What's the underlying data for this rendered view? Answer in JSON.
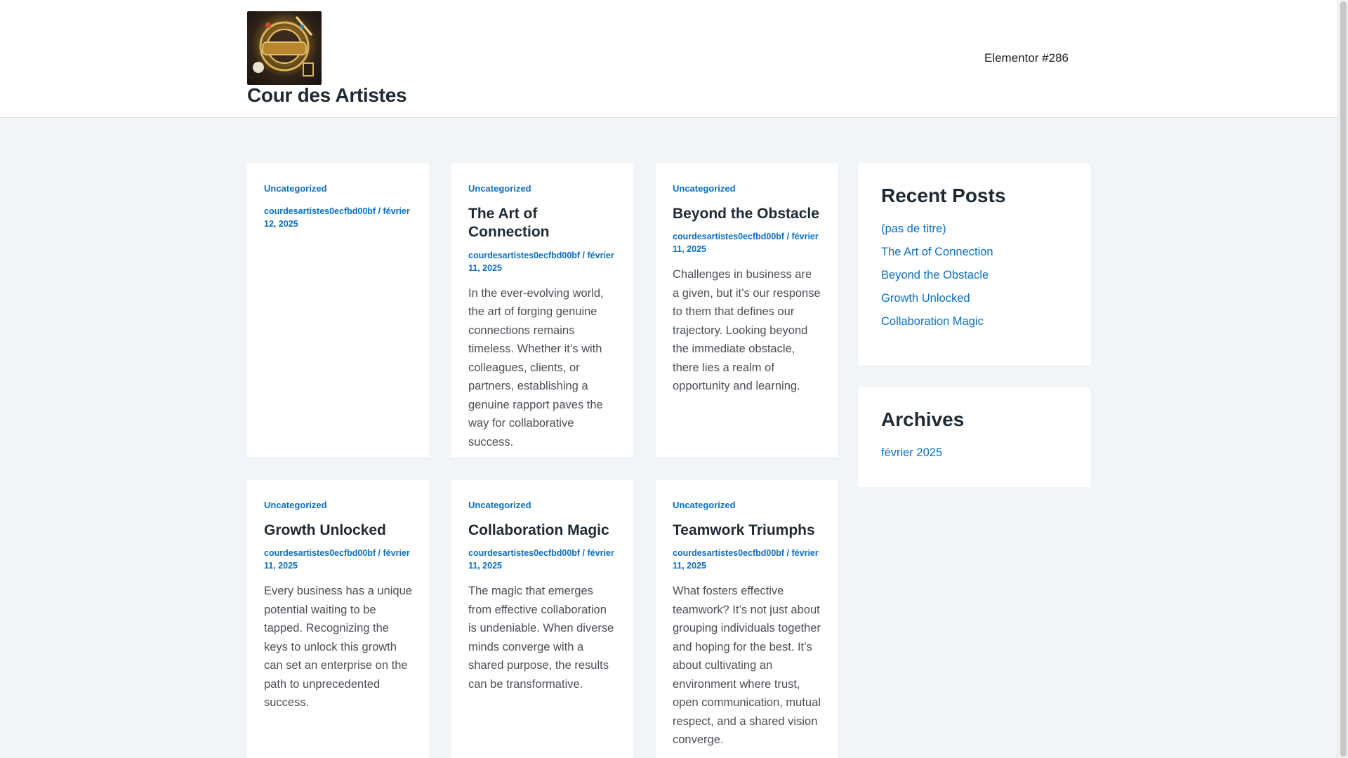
{
  "header": {
    "site_title": "Cour des Artistes",
    "nav_link": "Elementor #286"
  },
  "posts": [
    {
      "category": "Uncategorized",
      "title": "",
      "meta": "courdesartistes0ecfbd00bf / février 12, 2025",
      "excerpt": ""
    },
    {
      "category": "Uncategorized",
      "title": "The Art of Connection",
      "meta": "courdesartistes0ecfbd00bf / février 11, 2025",
      "excerpt": "In the ever-evolving world, the art of forging genuine connections remains timeless. Whether it’s with colleagues, clients, or partners, establishing a genuine rapport paves the way for collaborative success."
    },
    {
      "category": "Uncategorized",
      "title": "Beyond the Obstacle",
      "meta": "courdesartistes0ecfbd00bf / février 11, 2025",
      "excerpt": "Challenges in business are a given, but it’s our response to them that defines our trajectory. Looking beyond the immediate obstacle, there lies a realm of opportunity and learning."
    },
    {
      "category": "Uncategorized",
      "title": "Growth Unlocked",
      "meta": "courdesartistes0ecfbd00bf / février 11, 2025",
      "excerpt": "Every business has a unique potential waiting to be tapped. Recognizing the keys to unlock this growth can set an enterprise on the path to unprecedented success."
    },
    {
      "category": "Uncategorized",
      "title": "Collaboration Magic",
      "meta": "courdesartistes0ecfbd00bf / février 11, 2025",
      "excerpt": "The magic that emerges from effective collaboration is undeniable. When diverse minds converge with a shared purpose, the results can be transformative."
    },
    {
      "category": "Uncategorized",
      "title": "Teamwork Triumphs",
      "meta": "courdesartistes0ecfbd00bf / février 11, 2025",
      "excerpt": "What fosters effective teamwork? It’s not just about grouping individuals together and hoping for the best. It’s about cultivating an environment where trust, open communication, mutual respect, and a shared vision converge."
    }
  ],
  "sidebar": {
    "recent_posts": {
      "title": "Recent Posts",
      "items": [
        "(pas de titre)",
        "The Art of Connection",
        "Beyond the Obstacle",
        "Growth Unlocked",
        "Collaboration Magic"
      ]
    },
    "archives": {
      "title": "Archives",
      "items": [
        "février 2025"
      ]
    }
  }
}
